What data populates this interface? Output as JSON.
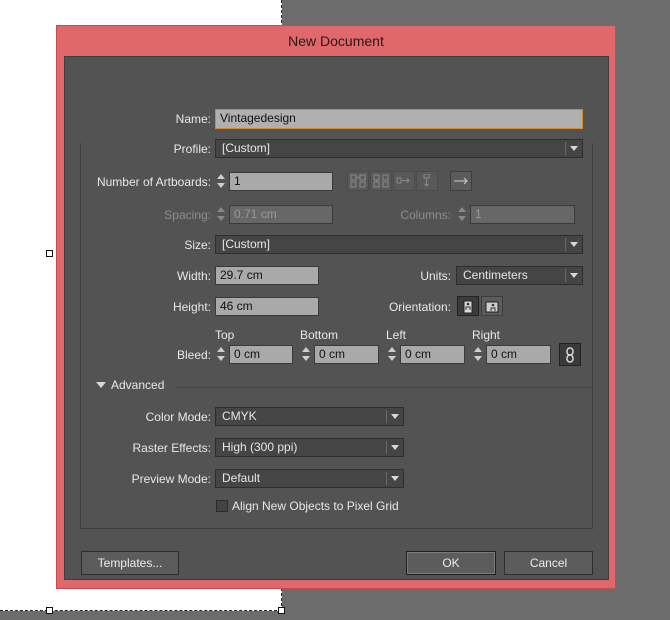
{
  "dialog": {
    "title": "New Document",
    "name_label": "Name:",
    "name_value": "Vintagedesign",
    "profile_label": "Profile:",
    "profile_value": "[Custom]",
    "artboards_label": "Number of Artboards:",
    "artboards_value": "1",
    "spacing_label": "Spacing:",
    "spacing_value": "0.71 cm",
    "columns_label": "Columns:",
    "columns_value": "1",
    "size_label": "Size:",
    "size_value": "[Custom]",
    "width_label": "Width:",
    "width_value": "29.7 cm",
    "units_label": "Units:",
    "units_value": "Centimeters",
    "height_label": "Height:",
    "height_value": "46 cm",
    "orientation_label": "Orientation:",
    "bleed_label": "Bleed:",
    "bleed": {
      "top_label": "Top",
      "top_value": "0 cm",
      "bottom_label": "Bottom",
      "bottom_value": "0 cm",
      "left_label": "Left",
      "left_value": "0 cm",
      "right_label": "Right",
      "right_value": "0 cm"
    },
    "advanced_label": "Advanced",
    "color_mode_label": "Color Mode:",
    "color_mode_value": "CMYK",
    "raster_label": "Raster Effects:",
    "raster_value": "High (300 ppi)",
    "preview_label": "Preview Mode:",
    "preview_value": "Default",
    "pixel_grid_label": "Align New Objects to Pixel Grid",
    "pixel_grid_checked": false,
    "templates_button": "Templates...",
    "ok_button": "OK",
    "cancel_button": "Cancel"
  },
  "icons": {
    "artboard_layout": [
      "grid-by-row-icon",
      "grid-by-column-icon",
      "arrange-by-row-icon",
      "arrange-by-column-icon",
      "right-to-left-icon"
    ],
    "orientation": [
      "portrait-icon",
      "landscape-icon"
    ],
    "bleed_link": "link-icon"
  },
  "colors": {
    "dialog_border": "#e0676a",
    "panel": "#535353",
    "field": "#a9a9a9",
    "focus": "#d48a2c"
  }
}
